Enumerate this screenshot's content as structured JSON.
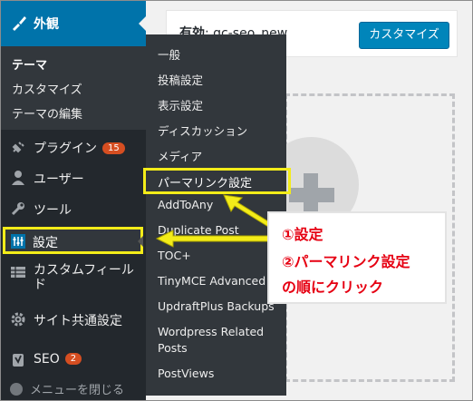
{
  "sidebar": {
    "appearance": {
      "label": "外観",
      "icon": "paintbrush-icon"
    },
    "appearance_submenu": [
      "テーマ",
      "カスタマイズ",
      "テーマの編集"
    ],
    "items": [
      {
        "label": "プラグイン",
        "badge": "15",
        "icon": "plugin-icon"
      },
      {
        "label": "ユーザー",
        "icon": "user-icon"
      },
      {
        "label": "ツール",
        "icon": "wrench-icon"
      },
      {
        "label": "設定",
        "icon": "settings-icon"
      },
      {
        "label": "カスタムフィールド",
        "icon": "table-icon"
      },
      {
        "label": "サイト共通設定",
        "icon": "gear-icon"
      },
      {
        "label": "SEO",
        "badge": "2",
        "icon": "yoast-icon"
      }
    ],
    "collapse_label": "メニューを閉じる"
  },
  "header": {
    "active_label": "有効",
    "theme_name": "gc-seo_new",
    "customize_button": "カスタマイズ"
  },
  "flyout": {
    "items": [
      "一般",
      "投稿設定",
      "表示設定",
      "ディスカッション",
      "メディア",
      "パーマリンク設定",
      "AddToAny",
      "Duplicate Post",
      "TOC+",
      "TinyMCE Advanced",
      "UpdraftPlus Backups",
      "Wordpress Related",
      "Posts",
      "PostViews"
    ]
  },
  "annotation": {
    "line1": "①設定",
    "line2": "②パーマリンク設定",
    "line3": "の順にクリック"
  },
  "colors": {
    "sidebar": "#23282d",
    "active": "#0073aa",
    "highlight": "#f3ec19",
    "annotation_text": "#e60012"
  }
}
